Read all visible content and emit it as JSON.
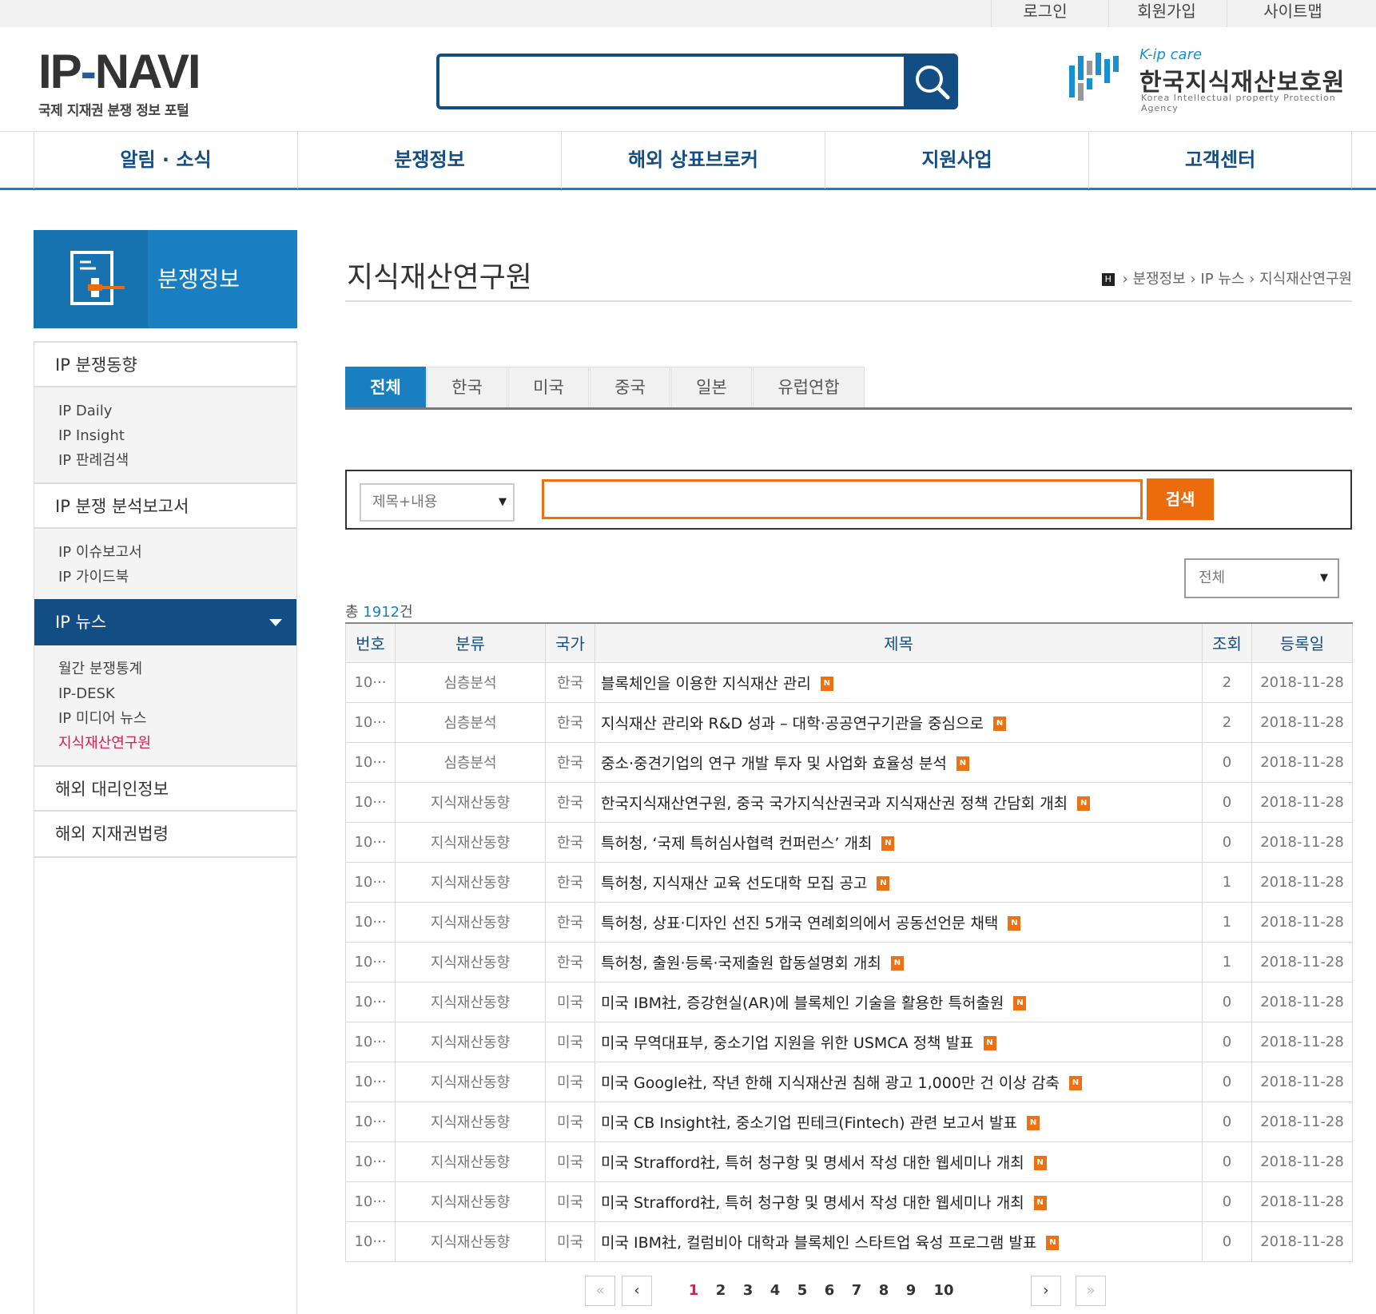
{
  "util_links": [
    "로그인",
    "회원가입",
    "사이트맵"
  ],
  "logo": {
    "part1": "IP",
    "slash": "-",
    "part2": "NAVI",
    "tagline": "국제 지재권 분쟁 정보 포털"
  },
  "agency": {
    "brand": "K-ip care",
    "name": "한국지식재산보호원",
    "english": "Korea Intellectual property Protection Agency"
  },
  "gnb": [
    "알림 · 소식",
    "분쟁정보",
    "해외 상표브로커",
    "지원사업",
    "고객센터"
  ],
  "sidebar": {
    "title": "분쟁정보",
    "groups": [
      {
        "label": "IP 분쟁동향",
        "subs": [
          "IP Daily",
          "IP Insight",
          "IP 판례검색"
        ]
      },
      {
        "label": "IP 분쟁 분석보고서",
        "subs": [
          "IP 이슈보고서",
          "IP 가이드북"
        ]
      },
      {
        "label": "IP 뉴스",
        "subs": [
          "월간 분쟁통계",
          "IP-DESK",
          "IP 미디어 뉴스",
          "지식재산연구원"
        ]
      },
      {
        "label": "해외 대리인정보"
      },
      {
        "label": "해외 지재권법령"
      }
    ]
  },
  "page": {
    "title": "지식재산연구원",
    "breadcrumb": [
      "분쟁정보",
      "IP 뉴스",
      "지식재산연구원"
    ],
    "home_icon": "H"
  },
  "tabs": [
    "전체",
    "한국",
    "미국",
    "중국",
    "일본",
    "유럽연합"
  ],
  "active_tab": "전체",
  "search": {
    "field": "제목+내용",
    "value": "",
    "button": "검색"
  },
  "filter": "전체",
  "total": {
    "prefix": "총 ",
    "count": "1912",
    "suffix": "건"
  },
  "table": {
    "headers": [
      "번호",
      "분류",
      "국가",
      "제목",
      "조회",
      "등록일"
    ],
    "rows": [
      {
        "no": "10···",
        "cat": "심층분석",
        "country": "한국",
        "title": "블록체인을 이용한 지식재산 관리",
        "views": "2",
        "date": "2018-11-28"
      },
      {
        "no": "10···",
        "cat": "심층분석",
        "country": "한국",
        "title": "지식재산 관리와 R&D 성과 – 대학·공공연구기관을 중심으로",
        "views": "2",
        "date": "2018-11-28"
      },
      {
        "no": "10···",
        "cat": "심층분석",
        "country": "한국",
        "title": "중소·중견기업의 연구 개발 투자 및 사업화 효율성 분석",
        "views": "0",
        "date": "2018-11-28"
      },
      {
        "no": "10···",
        "cat": "지식재산동향",
        "country": "한국",
        "title": "한국지식재산연구원, 중국 국가지식산권국과 지식재산권 정책 간담회 개최",
        "views": "0",
        "date": "2018-11-28"
      },
      {
        "no": "10···",
        "cat": "지식재산동향",
        "country": "한국",
        "title": "특허청, ‘국제 특허심사협력 컨퍼런스’ 개최",
        "views": "0",
        "date": "2018-11-28"
      },
      {
        "no": "10···",
        "cat": "지식재산동향",
        "country": "한국",
        "title": "특허청, 지식재산 교육 선도대학 모집 공고",
        "views": "1",
        "date": "2018-11-28"
      },
      {
        "no": "10···",
        "cat": "지식재산동향",
        "country": "한국",
        "title": "특허청, 상표·디자인 선진 5개국 연례회의에서 공동선언문 채택",
        "views": "1",
        "date": "2018-11-28"
      },
      {
        "no": "10···",
        "cat": "지식재산동향",
        "country": "한국",
        "title": "특허청, 출원·등록·국제출원 합동설명회 개최",
        "views": "1",
        "date": "2018-11-28"
      },
      {
        "no": "10···",
        "cat": "지식재산동향",
        "country": "미국",
        "title": "미국 IBM社, 증강현실(AR)에 블록체인 기술을 활용한 특허출원",
        "views": "0",
        "date": "2018-11-28"
      },
      {
        "no": "10···",
        "cat": "지식재산동향",
        "country": "미국",
        "title": "미국 무역대표부, 중소기업 지원을 위한 USMCA 정책 발표",
        "views": "0",
        "date": "2018-11-28"
      },
      {
        "no": "10···",
        "cat": "지식재산동향",
        "country": "미국",
        "title": "미국 Google社, 작년 한해 지식재산권 침해 광고 1,000만 건 이상 감축",
        "views": "0",
        "date": "2018-11-28"
      },
      {
        "no": "10···",
        "cat": "지식재산동향",
        "country": "미국",
        "title": "미국 CB Insight社, 중소기업 핀테크(Fintech) 관련 보고서 발표",
        "views": "0",
        "date": "2018-11-28"
      },
      {
        "no": "10···",
        "cat": "지식재산동향",
        "country": "미국",
        "title": "미국 Strafford社, 특허 청구항 및 명세서 작성 대한 웹세미나 개최",
        "views": "0",
        "date": "2018-11-28"
      },
      {
        "no": "10···",
        "cat": "지식재산동향",
        "country": "미국",
        "title": "미국 Strafford社, 특허 청구항 및 명세서 작성 대한 웹세미나 개최",
        "views": "0",
        "date": "2018-11-28"
      },
      {
        "no": "10···",
        "cat": "지식재산동향",
        "country": "미국",
        "title": "미국 IBM社, 컬럼비아 대학과 블록체인 스타트업 육성 프로그램 발표",
        "views": "0",
        "date": "2018-11-28"
      }
    ],
    "new_badge": "N"
  },
  "pagination": {
    "first": "«",
    "prev": "‹",
    "next": "›",
    "last": "»",
    "pages": [
      "1",
      "2",
      "3",
      "4",
      "5",
      "6",
      "7",
      "8",
      "9",
      "10"
    ],
    "current": "1"
  },
  "colors": {
    "navy": "#124d84",
    "blue": "#1a7fc1",
    "orange": "#ec6b0c",
    "red": "#d6204c"
  }
}
